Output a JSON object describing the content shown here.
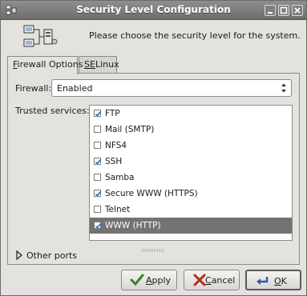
{
  "window": {
    "title": "Security Level Configuration"
  },
  "header": {
    "message": "Please choose the security level for the system."
  },
  "tabs": [
    {
      "label": "Firewall Options",
      "mnemonic": "F",
      "rest": "irewall Options"
    },
    {
      "label": "SELinux",
      "mnemonic": "SE",
      "rest": "Linux"
    }
  ],
  "firewall": {
    "label": "Firewall:",
    "value": "Enabled"
  },
  "trusted": {
    "label": "Trusted services:",
    "services": [
      {
        "name": "FTP",
        "checked": true
      },
      {
        "name": "Mail (SMTP)",
        "checked": false
      },
      {
        "name": "NFS4",
        "checked": false
      },
      {
        "name": "SSH",
        "checked": true
      },
      {
        "name": "Samba",
        "checked": false
      },
      {
        "name": "Secure WWW (HTTPS)",
        "checked": true
      },
      {
        "name": "Telnet",
        "checked": false
      },
      {
        "name": "WWW (HTTP)",
        "checked": true,
        "selected": true
      }
    ]
  },
  "other_ports": {
    "label": "Other ports"
  },
  "buttons": {
    "apply": {
      "label": "Apply",
      "mnemonic": "A",
      "rest": "pply"
    },
    "cancel": {
      "label": "Cancel",
      "mnemonic": "C",
      "rest": "ancel"
    },
    "ok": {
      "label": "OK",
      "mnemonic": "O",
      "rest": "K"
    }
  },
  "icons": {
    "window": "app-icon",
    "header": "network-computers-icon",
    "apply": "apply-check-icon",
    "cancel": "cancel-x-icon",
    "ok": "ok-arrow-icon",
    "expander": "triangle-right-icon"
  }
}
